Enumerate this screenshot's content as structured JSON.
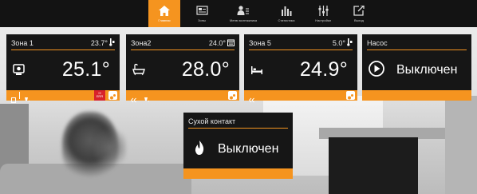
{
  "nav": [
    {
      "label": "Главная",
      "icon": "home-icon",
      "active": true
    },
    {
      "label": "Зоны",
      "icon": "zones-icon",
      "active": false
    },
    {
      "label": "Меню монтажника",
      "icon": "installer-menu-icon",
      "active": false
    },
    {
      "label": "Статистика",
      "icon": "statistics-icon",
      "active": false
    },
    {
      "label": "Настройки",
      "icon": "settings-icon",
      "active": false
    },
    {
      "label": "Выход",
      "icon": "exit-icon",
      "active": false
    }
  ],
  "zones": [
    {
      "name": "Зона 1",
      "set_temp": "23.7°",
      "current_temp": "25.1°",
      "mode_icon": "room-sensor-icon",
      "set_icon": "thermometer-hand-icon",
      "alarm": true
    },
    {
      "name": "Зона2",
      "set_temp": "24.0°",
      "current_temp": "28.0°",
      "mode_icon": "bathtub-icon",
      "set_icon": "schedule-icon",
      "alarm": false
    },
    {
      "name": "Зона 5",
      "set_temp": "5.0°",
      "current_temp": "24.9°",
      "mode_icon": "bed-icon",
      "set_icon": "thermometer-hand-icon",
      "alarm": false
    }
  ],
  "pump": {
    "title": "Насос",
    "status": "Выключен",
    "icon": "play-icon"
  },
  "dry_contact": {
    "title": "Сухой контакт",
    "status": "Выключен",
    "icon": "flame-icon"
  },
  "colors": {
    "accent": "#f5941f",
    "tile_bg": "#161616",
    "topbar_bg": "#131313",
    "alarm": "#d8222a"
  }
}
